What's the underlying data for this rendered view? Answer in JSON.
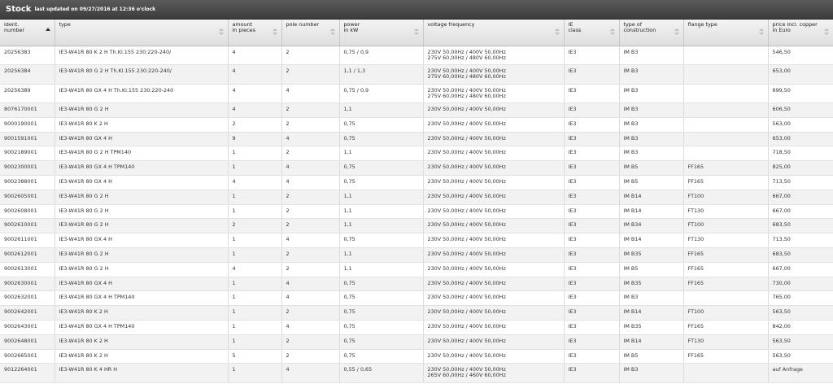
{
  "window": {
    "title": "Stock",
    "subtitle": "last updated on 09/27/2016 at 12:36 o'clock"
  },
  "table": {
    "columns": [
      {
        "key": "ident",
        "label": "ident.\nnumber",
        "sorted": true
      },
      {
        "key": "type",
        "label": "type",
        "sorted": false
      },
      {
        "key": "amount",
        "label": "amount\nin pieces",
        "sorted": false
      },
      {
        "key": "pole",
        "label": "pole number",
        "sorted": false
      },
      {
        "key": "power",
        "label": "power\nin kW",
        "sorted": false
      },
      {
        "key": "voltage",
        "label": "voltage frequency",
        "sorted": false
      },
      {
        "key": "ie",
        "label": "IE\nclass",
        "sorted": false
      },
      {
        "key": "construction",
        "label": "type of\nconstruction",
        "sorted": false
      },
      {
        "key": "flange",
        "label": "flange type",
        "sorted": false
      },
      {
        "key": "price",
        "label": "price incl. copper\nin Euro",
        "sorted": false
      }
    ],
    "rows": [
      {
        "ident": "20256383",
        "type": "IE3-W41R 80 K 2 H Th.Kl.155 230:220-240/",
        "amount": "4",
        "pole": "2",
        "power": "0,75 / 0,9",
        "voltage": "230V 50,00Hz / 400V 50,00Hz\n275V 60,00Hz / 480V 60,00Hz",
        "ie": "IE3",
        "construction": "IM B3",
        "flange": "",
        "price": "546,50"
      },
      {
        "ident": "20256384",
        "type": "IE3-W41R 80 G 2 H Th.Kl.155 230:220-240/",
        "amount": "4",
        "pole": "2",
        "power": "1,1 / 1,3",
        "voltage": "230V 50,00Hz / 400V 50,00Hz\n275V 60,00Hz / 480V 60,00Hz",
        "ie": "IE3",
        "construction": "IM B3",
        "flange": "",
        "price": "653,00"
      },
      {
        "ident": "20256389",
        "type": "IE3-W41R 80 GX 4 H Th.Kl.155 230:220-240",
        "amount": "4",
        "pole": "4",
        "power": "0,75 / 0,9",
        "voltage": "230V 50,00Hz / 400V 50,00Hz\n275V 60,00Hz / 480V 60,00Hz",
        "ie": "IE3",
        "construction": "IM B3",
        "flange": "",
        "price": "699,50"
      },
      {
        "ident": "8076170001",
        "type": "IE3-W41R 80 G 2 H",
        "amount": "4",
        "pole": "2",
        "power": "1,1",
        "voltage": "230V 50,00Hz / 400V 50,00Hz",
        "ie": "IE3",
        "construction": "IM B3",
        "flange": "",
        "price": "606,50"
      },
      {
        "ident": "9000190001",
        "type": "IE3-W41R 80 K 2 H",
        "amount": "2",
        "pole": "2",
        "power": "0,75",
        "voltage": "230V 50,00Hz / 400V 50,00Hz",
        "ie": "IE3",
        "construction": "IM B3",
        "flange": "",
        "price": "563,00"
      },
      {
        "ident": "9001591001",
        "type": "IE3-W41R 80 GX 4 H",
        "amount": "9",
        "pole": "4",
        "power": "0,75",
        "voltage": "230V 50,00Hz / 400V 50,00Hz",
        "ie": "IE3",
        "construction": "IM B3",
        "flange": "",
        "price": "653,00"
      },
      {
        "ident": "9002189001",
        "type": "IE3-W41R 80 G 2 H TPM140",
        "amount": "1",
        "pole": "2",
        "power": "1,1",
        "voltage": "230V 50,00Hz / 400V 50,00Hz",
        "ie": "IE3",
        "construction": "IM B3",
        "flange": "",
        "price": "718,50"
      },
      {
        "ident": "9002300001",
        "type": "IE3-W41R 80 GX 4 H TPM140",
        "amount": "1",
        "pole": "4",
        "power": "0,75",
        "voltage": "230V 50,00Hz / 400V 50,00Hz",
        "ie": "IE3",
        "construction": "IM B5",
        "flange": "FF165",
        "price": "825,00"
      },
      {
        "ident": "9002388001",
        "type": "IE3-W41R 80 GX 4 H",
        "amount": "4",
        "pole": "4",
        "power": "0,75",
        "voltage": "230V 50,00Hz / 400V 50,00Hz",
        "ie": "IE3",
        "construction": "IM B5",
        "flange": "FF165",
        "price": "713,50"
      },
      {
        "ident": "9002605001",
        "type": "IE3-W41R 80 G 2 H",
        "amount": "1",
        "pole": "2",
        "power": "1,1",
        "voltage": "230V 50,00Hz / 400V 50,00Hz",
        "ie": "IE3",
        "construction": "IM B14",
        "flange": "FT100",
        "price": "667,00"
      },
      {
        "ident": "9002608001",
        "type": "IE3-W41R 80 G 2 H",
        "amount": "1",
        "pole": "2",
        "power": "1,1",
        "voltage": "230V 50,00Hz / 400V 50,00Hz",
        "ie": "IE3",
        "construction": "IM B14",
        "flange": "FT130",
        "price": "667,00"
      },
      {
        "ident": "9002610001",
        "type": "IE3-W41R 80 G 2 H",
        "amount": "2",
        "pole": "2",
        "power": "1,1",
        "voltage": "230V 50,00Hz / 400V 50,00Hz",
        "ie": "IE3",
        "construction": "IM B34",
        "flange": "FT100",
        "price": "683,50"
      },
      {
        "ident": "9002611001",
        "type": "IE3-W41R 80 GX 4 H",
        "amount": "1",
        "pole": "4",
        "power": "0,75",
        "voltage": "230V 50,00Hz / 400V 50,00Hz",
        "ie": "IE3",
        "construction": "IM B14",
        "flange": "FT130",
        "price": "713,50"
      },
      {
        "ident": "9002612001",
        "type": "IE3-W41R 80 G 2 H",
        "amount": "1",
        "pole": "2",
        "power": "1,1",
        "voltage": "230V 50,00Hz / 400V 50,00Hz",
        "ie": "IE3",
        "construction": "IM B35",
        "flange": "FF165",
        "price": "683,50"
      },
      {
        "ident": "9002613001",
        "type": "IE3-W41R 80 G 2 H",
        "amount": "4",
        "pole": "2",
        "power": "1,1",
        "voltage": "230V 50,00Hz / 400V 50,00Hz",
        "ie": "IE3",
        "construction": "IM B5",
        "flange": "FF165",
        "price": "667,00"
      },
      {
        "ident": "9002630001",
        "type": "IE3-W41R 80 GX 4 H",
        "amount": "1",
        "pole": "4",
        "power": "0,75",
        "voltage": "230V 50,00Hz / 400V 50,00Hz",
        "ie": "IE3",
        "construction": "IM B35",
        "flange": "FF165",
        "price": "730,00"
      },
      {
        "ident": "9002632001",
        "type": "IE3-W41R 80 GX 4 H TPM140",
        "amount": "1",
        "pole": "4",
        "power": "0,75",
        "voltage": "230V 50,00Hz / 400V 50,00Hz",
        "ie": "IE3",
        "construction": "IM B3",
        "flange": "",
        "price": "765,00"
      },
      {
        "ident": "9002642001",
        "type": "IE3-W41R 80 K 2 H",
        "amount": "1",
        "pole": "2",
        "power": "0,75",
        "voltage": "230V 50,00Hz / 400V 50,00Hz",
        "ie": "IE3",
        "construction": "IM B14",
        "flange": "FT100",
        "price": "563,50"
      },
      {
        "ident": "9002643001",
        "type": "IE3-W41R 80 GX 4 H TPM140",
        "amount": "1",
        "pole": "4",
        "power": "0,75",
        "voltage": "230V 50,00Hz / 400V 50,00Hz",
        "ie": "IE3",
        "construction": "IM B35",
        "flange": "FF165",
        "price": "842,00"
      },
      {
        "ident": "9002648001",
        "type": "IE3-W41R 80 K 2 H",
        "amount": "1",
        "pole": "2",
        "power": "0,75",
        "voltage": "230V 50,00Hz / 400V 50,00Hz",
        "ie": "IE3",
        "construction": "IM B14",
        "flange": "FT130",
        "price": "563,50"
      },
      {
        "ident": "9002665001",
        "type": "IE3-W41R 80 K 2 H",
        "amount": "5",
        "pole": "2",
        "power": "0,75",
        "voltage": "230V 50,00Hz / 400V 50,00Hz",
        "ie": "IE3",
        "construction": "IM B5",
        "flange": "FF165",
        "price": "563,50"
      },
      {
        "ident": "9012264001",
        "type": "IE3-W41R 80 K 4 HR H",
        "amount": "1",
        "pole": "4",
        "power": "0,55 / 0,65",
        "voltage": "230V 50,00Hz / 400V 50,00Hz\n265V 60,00Hz / 460V 60,00Hz",
        "ie": "IE3",
        "construction": "IM B3",
        "flange": "",
        "price": "auf Anfrage"
      }
    ]
  }
}
